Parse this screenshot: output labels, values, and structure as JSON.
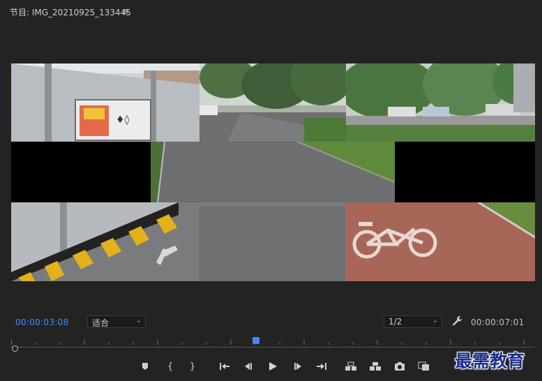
{
  "header": {
    "title": "节目: IMG_20210925_133445",
    "menu_icon": "hamburger-menu-icon"
  },
  "viewer": {
    "layout": "3x3 split with center column showing full road; left-middle and right-middle tiles black",
    "colors": {
      "background": "#232323",
      "frame": "#000000"
    }
  },
  "controls": {
    "current_timecode": "00:00:03:08",
    "fit_label": "适合",
    "resolution_label": "1/2",
    "duration_timecode": "00:00:07:01",
    "accent_color": "#3c8cff"
  },
  "transport": {
    "buttons": [
      "add-marker-icon",
      "mark-in-icon",
      "mark-out-icon",
      "go-to-in-icon",
      "step-back-icon",
      "play-icon",
      "step-forward-icon",
      "go-to-out-icon",
      "lift-icon",
      "extract-icon",
      "export-frame-icon",
      "comparison-view-icon"
    ]
  },
  "watermark": {
    "text": "最需教育"
  }
}
